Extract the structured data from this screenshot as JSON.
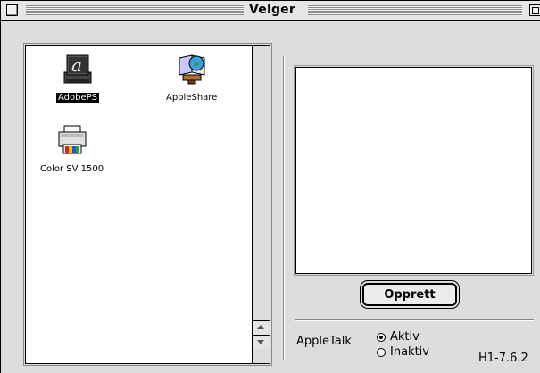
{
  "window": {
    "title": "Velger"
  },
  "devices": [
    {
      "label": "AdobePS",
      "icon": "adobeps-printer-icon",
      "selected": true
    },
    {
      "label": "AppleShare",
      "icon": "appleshare-icon",
      "selected": false
    },
    {
      "label": "Color SV 1500",
      "icon": "color-printer-icon",
      "selected": false
    }
  ],
  "right_panel": {
    "create_button_label": "Opprett"
  },
  "appletalk": {
    "label": "AppleTalk",
    "options": [
      {
        "label": "Aktiv",
        "selected": true
      },
      {
        "label": "Inaktiv",
        "selected": false
      }
    ]
  },
  "version": "H1-7.6.2",
  "colors": {
    "window_bg": "#dddddd",
    "list_bg": "#ffffff",
    "selection": "#000000"
  }
}
